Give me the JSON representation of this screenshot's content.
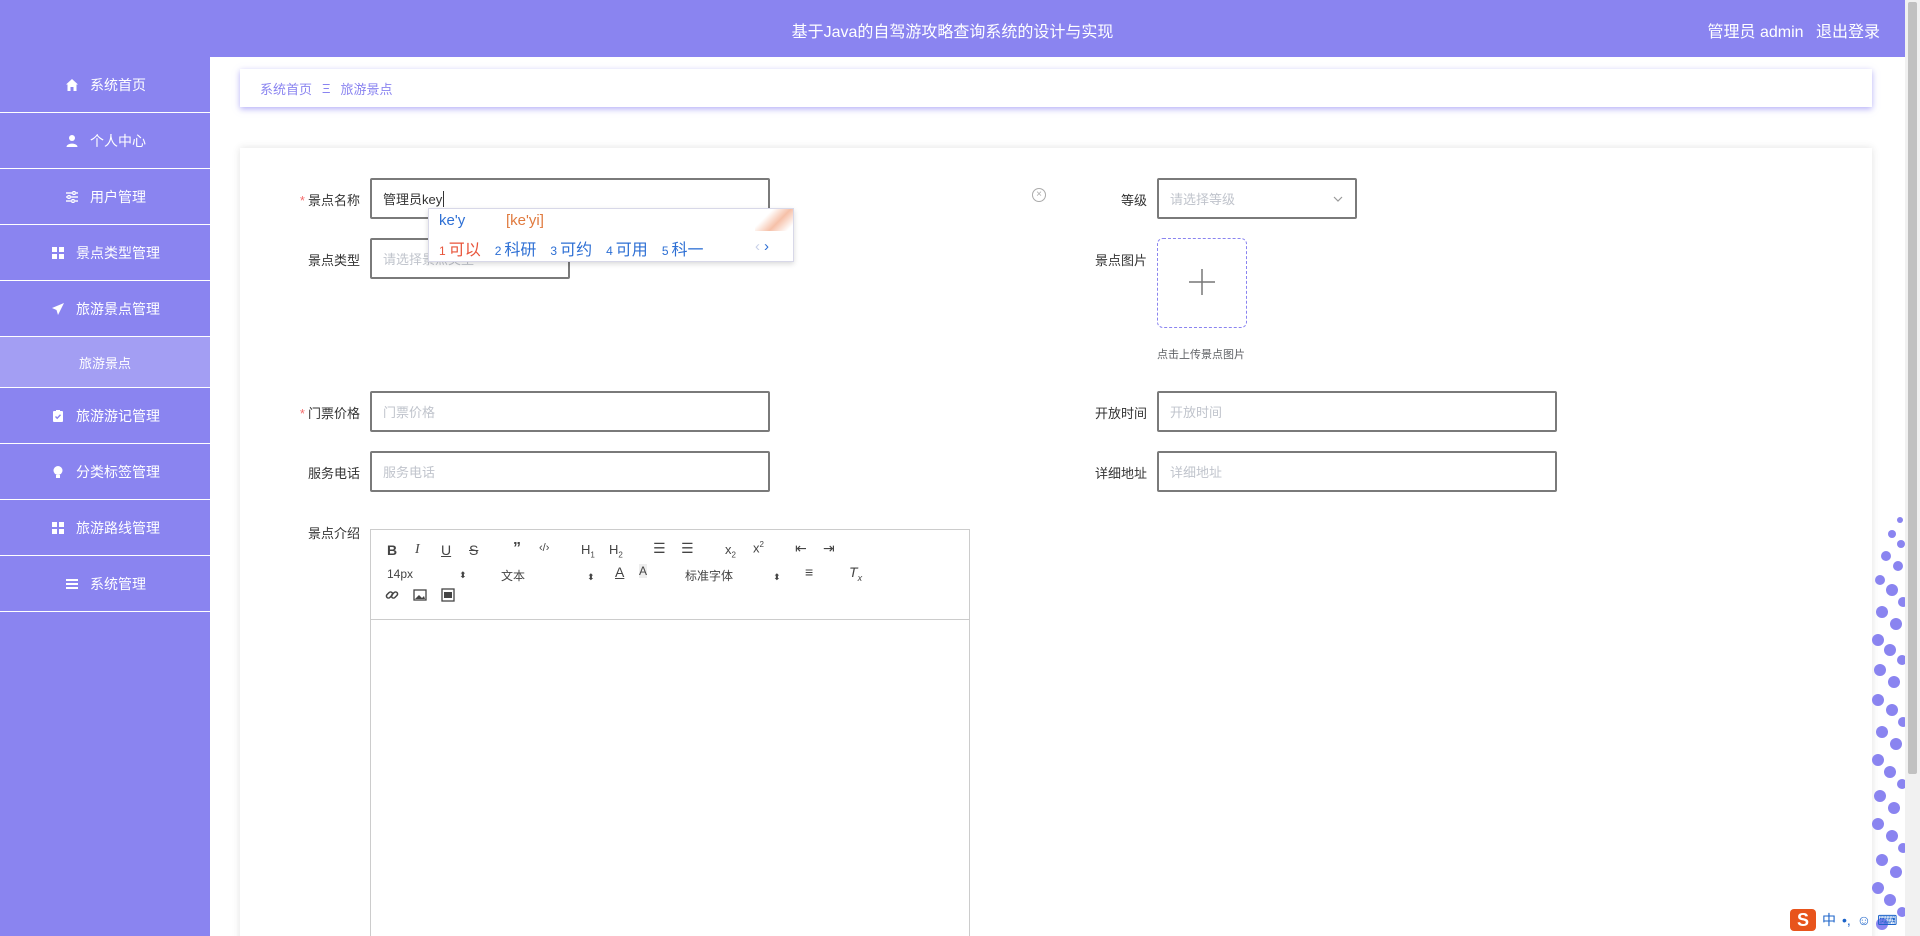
{
  "header": {
    "title": "基于Java的自驾游攻略查询系统的设计与实现",
    "role": "管理员 admin",
    "logout": "退出登录"
  },
  "sidebar": {
    "items": [
      {
        "label": "系统首页",
        "icon": "home-icon"
      },
      {
        "label": "个人中心",
        "icon": "user-icon"
      },
      {
        "label": "用户管理",
        "icon": "sliders-icon"
      },
      {
        "label": "景点类型管理",
        "icon": "grid-icon"
      },
      {
        "label": "旅游景点管理",
        "icon": "paper-plane-icon"
      },
      {
        "label": "旅游景点",
        "icon": ""
      },
      {
        "label": "旅游游记管理",
        "icon": "clipboard-check-icon"
      },
      {
        "label": "分类标签管理",
        "icon": "lightbulb-icon"
      },
      {
        "label": "旅游路线管理",
        "icon": "grid-icon"
      },
      {
        "label": "系统管理",
        "icon": "menu-icon"
      }
    ]
  },
  "breadcrumb": {
    "home": "系统首页",
    "current": "旅游景点",
    "separator": "Ξ"
  },
  "form": {
    "name_label": "景点名称",
    "name_value": "管理员key",
    "level_label": "等级",
    "level_placeholder": "请选择等级",
    "type_label": "景点类型",
    "type_placeholder": "请选择景点类型",
    "image_label": "景点图片",
    "image_tip": "点击上传景点图片",
    "price_label": "门票价格",
    "price_placeholder": "门票价格",
    "open_label": "开放时间",
    "open_placeholder": "开放时间",
    "phone_label": "服务电话",
    "phone_placeholder": "服务电话",
    "address_label": "详细地址",
    "address_placeholder": "详细地址",
    "intro_label": "景点介绍"
  },
  "editor": {
    "size": "14px",
    "heading": "文本",
    "font": "标准字体"
  },
  "ime": {
    "input": "ke'y",
    "pinyin": "[ke'yi]",
    "candidates": [
      {
        "n": "1",
        "text": "可以"
      },
      {
        "n": "2",
        "text": "科研"
      },
      {
        "n": "3",
        "text": "可约"
      },
      {
        "n": "4",
        "text": "可用"
      },
      {
        "n": "5",
        "text": "科一"
      }
    ]
  },
  "taskbar": {
    "ime_logo": "S",
    "lang": "中"
  },
  "colors": {
    "primary": "#8a84f0",
    "sub_active": "#a39ef3",
    "required": "#f56c6c"
  }
}
